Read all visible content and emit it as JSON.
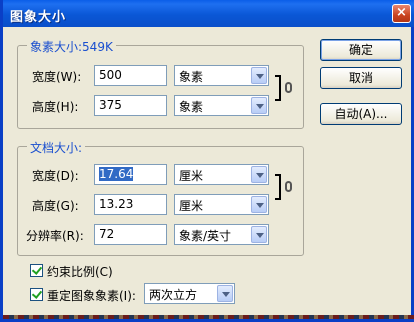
{
  "window": {
    "title": "图象大小",
    "close_glyph": "×"
  },
  "pixel_group": {
    "legend": "象素大小:549K",
    "width": {
      "label": "宽度(W):",
      "value": "500",
      "unit": "象素"
    },
    "height": {
      "label": "高度(H):",
      "value": "375",
      "unit": "象素"
    }
  },
  "doc_group": {
    "legend": "文档大小:",
    "width": {
      "label": "宽度(D):",
      "value": "17.64",
      "unit": "厘米"
    },
    "height": {
      "label": "高度(G):",
      "value": "13.23",
      "unit": "厘米"
    },
    "resolution": {
      "label": "分辨率(R):",
      "value": "72",
      "unit": "象素/英寸"
    }
  },
  "options": {
    "constrain_label": "约束比例(C)",
    "constrain_checked": true,
    "resample_label": "重定图象象素(I):",
    "resample_checked": true,
    "resample_method": "两次立方"
  },
  "buttons": {
    "ok": "确定",
    "cancel": "取消",
    "auto": "自动(A)..."
  },
  "icons": [
    "close-icon",
    "link-chain-icon",
    "dropdown-arrow-icon",
    "checkmark-icon"
  ],
  "colors": {
    "titlebar": "#0a57d6",
    "legend_text": "#1a4fcf",
    "selection": "#316ac5",
    "dialog_bg": "#ece9d8"
  }
}
